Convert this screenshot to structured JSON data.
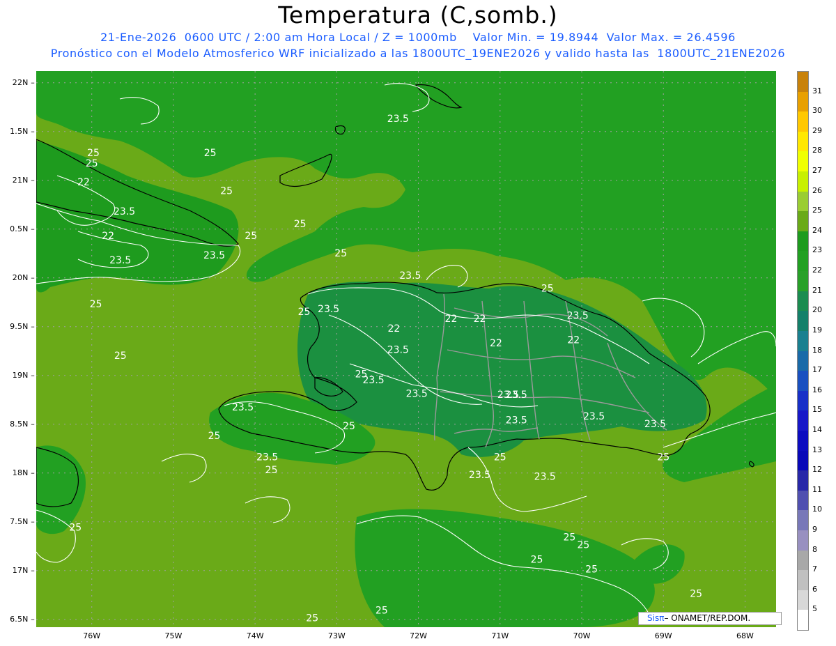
{
  "header": {
    "title": "Temperatura (C,somb.)",
    "line1": "21-Ene-2026  0600 UTC / 2:00 am Hora Local / Z = 1000mb    Valor Min. = 19.8944  Valor Max. = 26.4596",
    "line2": "Pronóstico con el Modelo Atmosferico WRF inicializado a las 1800UTC_19ENE2026 y valido hasta las  1800UTC_21ENE2026"
  },
  "map": {
    "lat_labels": [
      "22N",
      "1.5N",
      "21N",
      "0.5N",
      "20N",
      "9.5N",
      "19N",
      "8.5N",
      "18N",
      "7.5N",
      "17N",
      "6.5N"
    ],
    "lat_values": [
      22,
      21.5,
      21,
      20.5,
      20,
      19.5,
      19,
      18.5,
      18,
      17.5,
      17,
      16.5
    ],
    "lon_labels": [
      "76W",
      "75W",
      "74W",
      "73W",
      "72W",
      "71W",
      "70W",
      "69W",
      "68W"
    ],
    "lon_values": [
      -76,
      -75,
      -74,
      -73,
      -72,
      -71,
      -70,
      -69,
      -68
    ],
    "lon_range": [
      -76.68,
      -67.62
    ],
    "lat_range": [
      16.42,
      22.12
    ],
    "contour_labels": [
      {
        "text": "23.5",
        "lon": -72.25,
        "lat": 21.6
      },
      {
        "text": "25",
        "lon": -75.98,
        "lat": 21.25
      },
      {
        "text": "25",
        "lon": -76.0,
        "lat": 21.14
      },
      {
        "text": "25",
        "lon": -74.55,
        "lat": 21.25
      },
      {
        "text": "22",
        "lon": -76.1,
        "lat": 20.95
      },
      {
        "text": "25",
        "lon": -74.35,
        "lat": 20.86
      },
      {
        "text": "23.5",
        "lon": -75.6,
        "lat": 20.65
      },
      {
        "text": "25",
        "lon": -73.45,
        "lat": 20.52
      },
      {
        "text": "22",
        "lon": -75.8,
        "lat": 20.4
      },
      {
        "text": "25",
        "lon": -74.05,
        "lat": 20.4
      },
      {
        "text": "23.5",
        "lon": -75.65,
        "lat": 20.15
      },
      {
        "text": "23.5",
        "lon": -74.5,
        "lat": 20.2
      },
      {
        "text": "25",
        "lon": -72.95,
        "lat": 20.22
      },
      {
        "text": "23.5",
        "lon": -72.1,
        "lat": 19.99
      },
      {
        "text": "25",
        "lon": -70.42,
        "lat": 19.86
      },
      {
        "text": "25",
        "lon": -67.4,
        "lat": 19.8
      },
      {
        "text": "25",
        "lon": -75.95,
        "lat": 19.7
      },
      {
        "text": "25",
        "lon": -73.4,
        "lat": 19.62
      },
      {
        "text": "23.5",
        "lon": -73.1,
        "lat": 19.65
      },
      {
        "text": "22",
        "lon": -71.6,
        "lat": 19.55
      },
      {
        "text": "22",
        "lon": -71.25,
        "lat": 19.55
      },
      {
        "text": "23.5",
        "lon": -70.05,
        "lat": 19.58
      },
      {
        "text": "22",
        "lon": -72.3,
        "lat": 19.45
      },
      {
        "text": "22",
        "lon": -71.05,
        "lat": 19.3
      },
      {
        "text": "22",
        "lon": -70.1,
        "lat": 19.33
      },
      {
        "text": "23.5",
        "lon": -72.25,
        "lat": 19.23
      },
      {
        "text": "25",
        "lon": -75.65,
        "lat": 19.17
      },
      {
        "text": "25",
        "lon": -72.7,
        "lat": 18.98
      },
      {
        "text": "23.5",
        "lon": -72.55,
        "lat": 18.92
      },
      {
        "text": "23.5",
        "lon": -72.02,
        "lat": 18.78
      },
      {
        "text": "23.5",
        "lon": -70.9,
        "lat": 18.77
      },
      {
        "text": "23.5",
        "lon": -70.8,
        "lat": 18.77
      },
      {
        "text": "23.5",
        "lon": -74.15,
        "lat": 18.64
      },
      {
        "text": "23.5",
        "lon": -69.85,
        "lat": 18.55
      },
      {
        "text": "23.5",
        "lon": -70.8,
        "lat": 18.51
      },
      {
        "text": "23.5",
        "lon": -69.1,
        "lat": 18.47
      },
      {
        "text": "25",
        "lon": -72.85,
        "lat": 18.45
      },
      {
        "text": "25",
        "lon": -74.5,
        "lat": 18.35
      },
      {
        "text": "23.5",
        "lon": -73.85,
        "lat": 18.13
      },
      {
        "text": "25",
        "lon": -71.0,
        "lat": 18.13
      },
      {
        "text": "25",
        "lon": -69.0,
        "lat": 18.13
      },
      {
        "text": "25",
        "lon": -73.8,
        "lat": 18.0
      },
      {
        "text": "23.5",
        "lon": -71.25,
        "lat": 17.95
      },
      {
        "text": "23.5",
        "lon": -70.45,
        "lat": 17.93
      },
      {
        "text": "25",
        "lon": -76.2,
        "lat": 17.41
      },
      {
        "text": "25",
        "lon": -70.15,
        "lat": 17.31
      },
      {
        "text": "25",
        "lon": -69.98,
        "lat": 17.23
      },
      {
        "text": "25",
        "lon": -70.55,
        "lat": 17.08
      },
      {
        "text": "25",
        "lon": -69.88,
        "lat": 16.98
      },
      {
        "text": "25",
        "lon": -68.6,
        "lat": 16.73
      },
      {
        "text": "25",
        "lon": -72.45,
        "lat": 16.56
      },
      {
        "text": "25",
        "lon": -73.3,
        "lat": 16.48
      }
    ]
  },
  "legend": {
    "labels": [
      "31",
      "30",
      "29",
      "28",
      "27",
      "26",
      "25",
      "24",
      "23",
      "22",
      "21",
      "20",
      "19",
      "18",
      "17",
      "16",
      "15",
      "14",
      "13",
      "12",
      "11",
      "10",
      "9",
      "8",
      "7",
      "6",
      "5"
    ],
    "colors": [
      "#c8820a",
      "#e8a000",
      "#ffc800",
      "#ffe800",
      "#f0ff00",
      "#c8f000",
      "#9acd32",
      "#6aaa18",
      "#1e9b1e",
      "#22a022",
      "#28a028",
      "#1b8c50",
      "#15806a",
      "#1a8090",
      "#1a6aa8",
      "#1a50c0",
      "#1830c8",
      "#1818c8",
      "#0c0cc0",
      "#0808b8",
      "#2828a8",
      "#5050b0",
      "#7878b8",
      "#9890c0",
      "#a8a8a8",
      "#c0c0c0",
      "#d8d8d8",
      "#ffffff"
    ]
  },
  "credit": {
    "brand": "Sisπ",
    "text": "– ONAMET/REP.DOM."
  }
}
